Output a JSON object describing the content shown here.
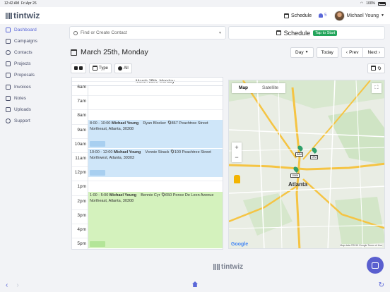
{
  "status": {
    "time": "12:42 AM",
    "date": "Fri Apr 26",
    "battery": "100%"
  },
  "header": {
    "logo_text": "tintwiz",
    "schedule_label": "Schedule",
    "notification_count": "5",
    "user_name": "Michael Young"
  },
  "sidebar": {
    "items": [
      {
        "label": "Dashboard",
        "active": true
      },
      {
        "label": "Campaigns"
      },
      {
        "label": "Contacts"
      },
      {
        "label": "Projects"
      },
      {
        "label": "Proposals"
      },
      {
        "label": "Invoices"
      },
      {
        "label": "Notes"
      },
      {
        "label": "Uploads"
      },
      {
        "label": "Support"
      }
    ]
  },
  "search": {
    "placeholder": "Find or Create Contact"
  },
  "schedule_button": {
    "label": "Schedule",
    "badge": "Tap to Start"
  },
  "date_bar": {
    "title": "March 25th, Monday",
    "view_label": "Day",
    "today_label": "Today",
    "prev_label": "Prev",
    "next_label": "Next"
  },
  "filters": {
    "type_label": "Type",
    "all_label": "All"
  },
  "calendar": {
    "header": "March 25th, Monday",
    "hours": [
      "6am",
      "7am",
      "8am",
      "9am",
      "10am",
      "11am",
      "12pm",
      "1pm",
      "2pm",
      "3pm",
      "4pm",
      "5pm"
    ],
    "events": [
      {
        "time": "8:00 - 10:00",
        "owner": "Michael Young",
        "client": "Ryan Blocker",
        "address": "867 Peachtree Street",
        "area": "Northeast, Atlanta, 30308",
        "color": "blue"
      },
      {
        "time": "10:00 - 12:00",
        "owner": "Michael Young",
        "client": "Vonnie Strack",
        "address": "100 Peachtree Street",
        "area": "Northwest, Atlanta, 30303",
        "color": "blue"
      },
      {
        "time": "1:00 - 5:00",
        "owner": "Michael Young",
        "client": "Bennie Cyr",
        "address": "650 Ponce De Leon Avenue",
        "area": "Northeast, Atlanta, 30308",
        "color": "green"
      }
    ]
  },
  "map": {
    "tabs": [
      "Map",
      "Satellite"
    ],
    "city": "Atlanta",
    "markers": [
      "8AM",
      "1PM",
      "10AM"
    ],
    "google": "Google",
    "attribution": "Map data ©2019 Google   Terms of Use"
  },
  "footer": {
    "logo_text": "tintwiz"
  },
  "colors": {
    "accent": "#5a67d8",
    "event_blue": "#cfe6f9",
    "event_green": "#d4f2bd",
    "badge_green": "#22a55b"
  }
}
